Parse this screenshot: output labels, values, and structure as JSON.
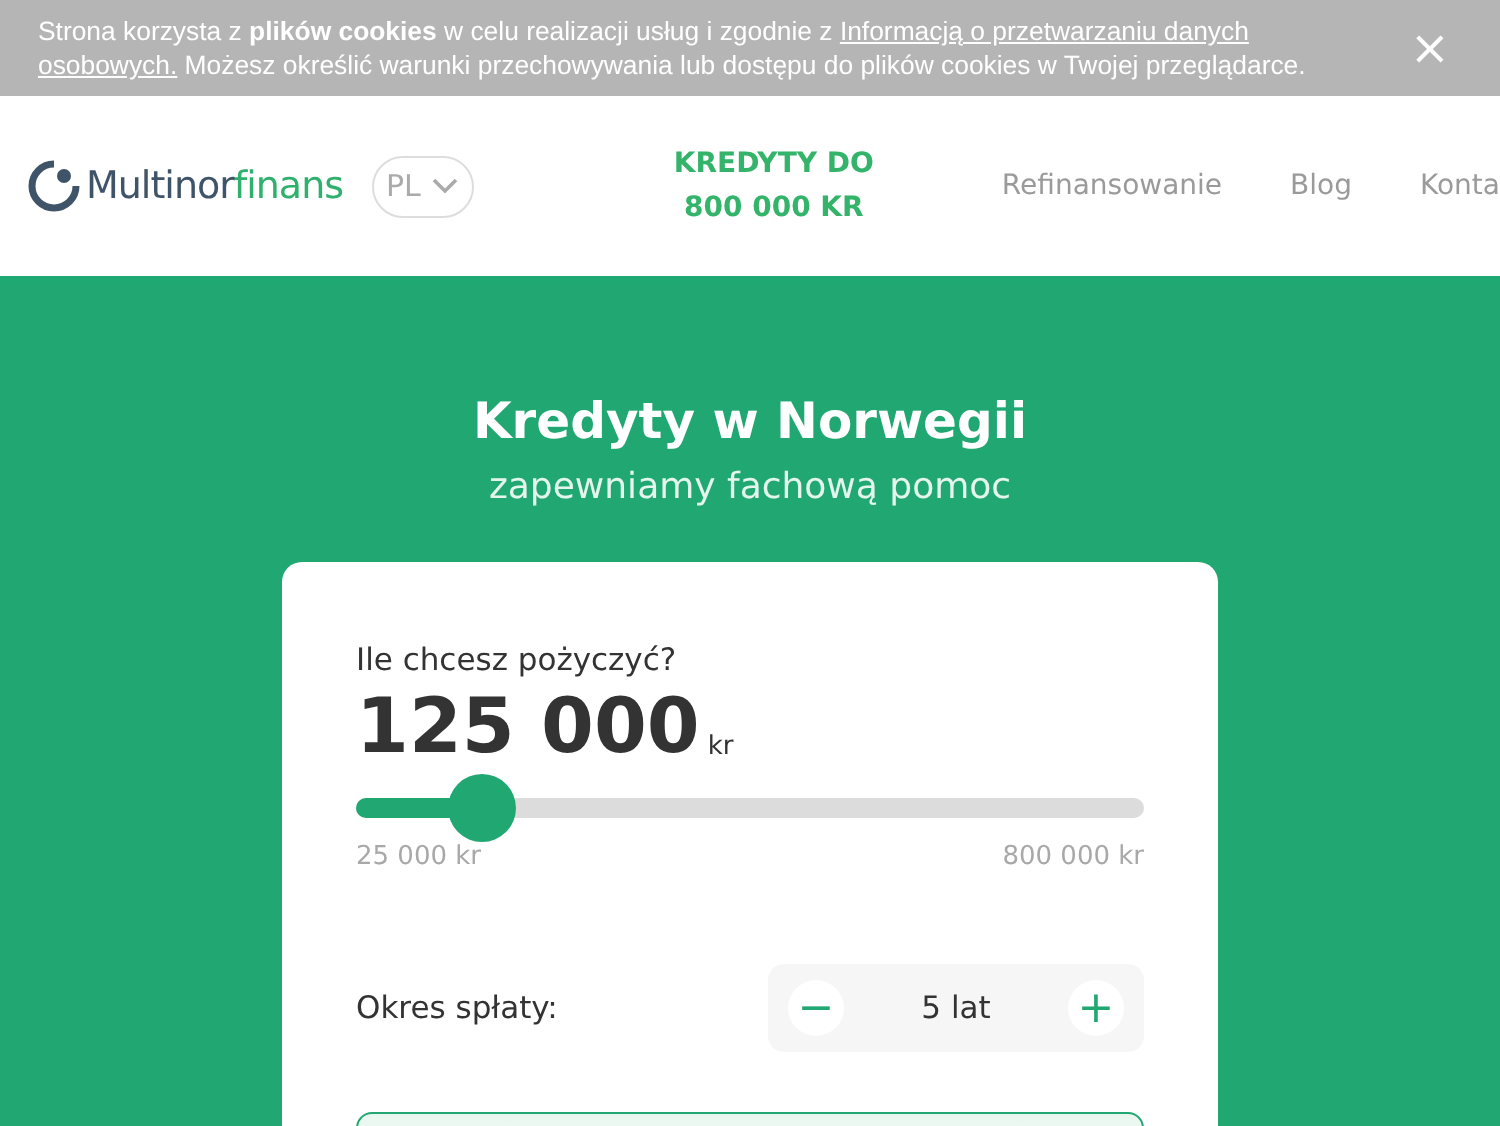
{
  "cookie_bar": {
    "text": "Strona korzysta z **plików cookies** w celu realizacji usług i zgodnie z ",
    "link": "Informacją o przetwarzaniu danych",
    "link_2": "osobowych.",
    "text_after": " Możesz określić warunki przechowywania lub dostępu do plików cookies w Twojej przeglądarce.",
    "close": "×"
  },
  "header": {
    "logo_main": "Multinor",
    "logo_accent": "finans",
    "language": "PL",
    "promo_line_1": "KREDYTY DO",
    "promo_line_2": "800 000 KR",
    "nav": [
      {
        "label": "Refinansowanie"
      },
      {
        "label": "Blog"
      },
      {
        "label": "Konta"
      }
    ]
  },
  "hero": {
    "title": "Kredyty w Norwegii",
    "subtitle": "zapewniamy fachową pomoc"
  },
  "calculator": {
    "question": "Ile chcesz pożyczyć?",
    "amount": "125 000",
    "currency": "kr",
    "level": 0.16,
    "min_label": "25 000 kr",
    "max_label": "800 000 kr",
    "period_label": "Okres spłaty:",
    "period_value": "5 lat",
    "minus": "−",
    "plus": "+"
  }
}
